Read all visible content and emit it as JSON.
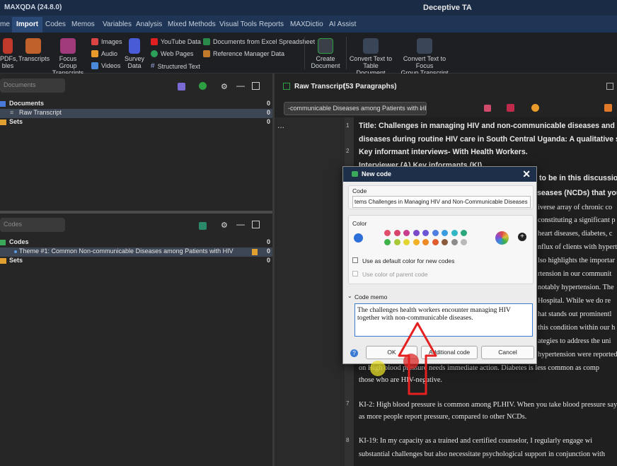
{
  "app": {
    "title": "MAXQDA (24.8.0)",
    "project": "Deceptive TA"
  },
  "menu": [
    "me",
    "Import",
    "Codes",
    "Memos",
    "Variables",
    "Analysis",
    "Mixed Methods",
    "Visual Tools",
    "Reports",
    "MAXDictio",
    "AI Assist"
  ],
  "ribbon": {
    "pdfs_line1": "PDFs,",
    "pdfs_line2": "bles",
    "transcripts": "Transcripts",
    "focus_group_line1": "Focus Group",
    "focus_group_line2": "Transcripts",
    "images": "Images",
    "audio": "Audio",
    "videos": "Videos",
    "survey_line1": "Survey",
    "survey_line2": "Data",
    "youtube": "YouTube Data",
    "webpages": "Web Pages",
    "structured": "Structured Text",
    "excel": "Documents from Excel Spreadsheet",
    "reference": "Reference Manager Data",
    "create_doc_line1": "Create",
    "create_doc_line2": "Document",
    "convert_table_line1": "Convert Text to",
    "convert_table_line2": "Table Document",
    "convert_focus_line1": "Convert Text to Focus",
    "convert_focus_line2": "Group Transcript"
  },
  "documents_pane": {
    "search_placeholder": "Documents",
    "rows": [
      {
        "label": "Documents",
        "count": "0"
      },
      {
        "label": "Raw Transcript",
        "count": "0"
      },
      {
        "label": "Sets",
        "count": "0"
      }
    ]
  },
  "codes_pane": {
    "search_placeholder": "Codes",
    "rows": [
      {
        "label": "Codes",
        "count": "0"
      },
      {
        "label": "Theme #1: Common Non-communicable Diseases among Patients with HIV",
        "count": "0"
      },
      {
        "label": "Sets",
        "count": "0"
      }
    ]
  },
  "document_browser": {
    "title": "Raw Transcript",
    "paragraphs": "(53 Paragraphs)",
    "selector": "-communicable Diseases among Patients with HIV",
    "ellipsis": "...",
    "para_numbers": [
      "1",
      "2",
      "7",
      "8"
    ],
    "lines": [
      "Title: Challenges in managing HIV and non-communicable diseases and healt",
      "diseases during routine HIV  care in South Central Uganda: A qualitative stud",
      "Key informant interviews- With Health Workers.",
      "Interviewer (A) Key informants (KI)",
      "to be in this discussion",
      "seases (NCDs) that you",
      "iverse array of chronic co",
      "constituting a significant p",
      "heart diseases, diabetes, c",
      "nflux of clients with hypert",
      "lso highlights the importar",
      "rtension in our communit",
      "notably hypertension. The",
      "Hospital. While we do re",
      "hat stands out prominentl",
      "this condition within our h",
      "ategies to address the uni",
      "hypertension were reported",
      "on  High blood pressure needs immediate action. Diabetes is less common as comp",
      "those who are HIV-negative.",
      "KI-2: High blood pressure is common among PLHIV. When you take blood pressure say",
      "as more people report pressure, compared to other NCDs.",
      "KI-19: In my capacity as a trained and certified counselor, I regularly engage wi",
      "substantial challenges but also necessitate psychological support in conjunction with"
    ]
  },
  "dialog": {
    "title": "New code",
    "code_label": "Code",
    "code_value": "tems Challenges in Managing HIV  and Non-Communicable Diseases",
    "color_label": "Color",
    "default_color_option": "Use as default color for new codes",
    "parent_color_option": "Use color of parent code",
    "memo_label": "Code memo",
    "memo_text": "The challenges health workers encounter managing HIV together with non-communicable diseases.",
    "ok": "OK",
    "additional": "Additional code",
    "cancel": "Cancel",
    "help": "?",
    "selected_color": "#2d6fd8",
    "palette": [
      "#e0506a",
      "#d9446b",
      "#c93d8e",
      "#7b4ac8",
      "#6a55d6",
      "#4f7fe0",
      "#3a9be0",
      "#30b6c4",
      "#2aa87a",
      "#3fb24a",
      "#a8c838",
      "#e3d631",
      "#f2b126",
      "#ee8a24",
      "#e05b2e",
      "#8a5a3c",
      "#8b8b8b",
      "#b9b9b9"
    ]
  }
}
